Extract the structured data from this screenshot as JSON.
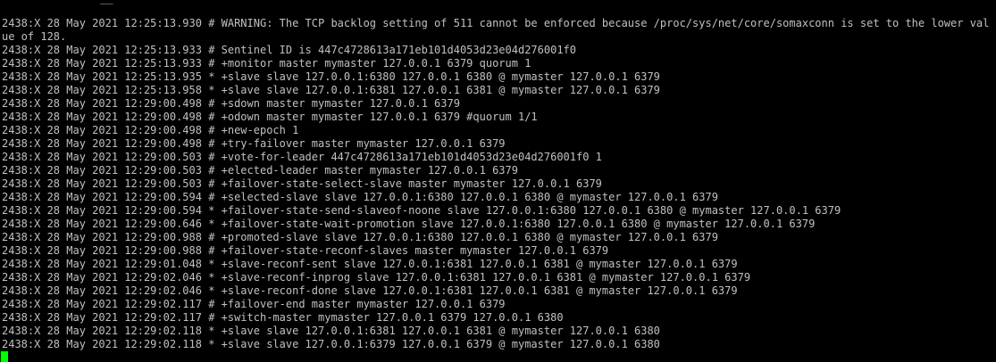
{
  "terminal": {
    "top_fragment": "__",
    "lines": [
      "2438:X 28 May 2021 12:25:13.930 # WARNING: The TCP backlog setting of 511 cannot be enforced because /proc/sys/net/core/somaxconn is set to the lower value of 128.",
      "2438:X 28 May 2021 12:25:13.933 # Sentinel ID is 447c4728613a171eb101d4053d23e04d276001f0",
      "2438:X 28 May 2021 12:25:13.933 # +monitor master mymaster 127.0.0.1 6379 quorum 1",
      "2438:X 28 May 2021 12:25:13.935 * +slave slave 127.0.0.1:6380 127.0.0.1 6380 @ mymaster 127.0.0.1 6379",
      "2438:X 28 May 2021 12:25:13.958 * +slave slave 127.0.0.1:6381 127.0.0.1 6381 @ mymaster 127.0.0.1 6379",
      "2438:X 28 May 2021 12:29:00.498 # +sdown master mymaster 127.0.0.1 6379",
      "2438:X 28 May 2021 12:29:00.498 # +odown master mymaster 127.0.0.1 6379 #quorum 1/1",
      "2438:X 28 May 2021 12:29:00.498 # +new-epoch 1",
      "2438:X 28 May 2021 12:29:00.498 # +try-failover master mymaster 127.0.0.1 6379",
      "2438:X 28 May 2021 12:29:00.503 # +vote-for-leader 447c4728613a171eb101d4053d23e04d276001f0 1",
      "2438:X 28 May 2021 12:29:00.503 # +elected-leader master mymaster 127.0.0.1 6379",
      "2438:X 28 May 2021 12:29:00.503 # +failover-state-select-slave master mymaster 127.0.0.1 6379",
      "2438:X 28 May 2021 12:29:00.594 # +selected-slave slave 127.0.0.1:6380 127.0.0.1 6380 @ mymaster 127.0.0.1 6379",
      "2438:X 28 May 2021 12:29:00.594 * +failover-state-send-slaveof-noone slave 127.0.0.1:6380 127.0.0.1 6380 @ mymaster 127.0.0.1 6379",
      "2438:X 28 May 2021 12:29:00.646 * +failover-state-wait-promotion slave 127.0.0.1:6380 127.0.0.1 6380 @ mymaster 127.0.0.1 6379",
      "2438:X 28 May 2021 12:29:00.988 # +promoted-slave slave 127.0.0.1:6380 127.0.0.1 6380 @ mymaster 127.0.0.1 6379",
      "2438:X 28 May 2021 12:29:00.988 # +failover-state-reconf-slaves master mymaster 127.0.0.1 6379",
      "2438:X 28 May 2021 12:29:01.048 * +slave-reconf-sent slave 127.0.0.1:6381 127.0.0.1 6381 @ mymaster 127.0.0.1 6379",
      "2438:X 28 May 2021 12:29:02.046 * +slave-reconf-inprog slave 127.0.0.1:6381 127.0.0.1 6381 @ mymaster 127.0.0.1 6379",
      "2438:X 28 May 2021 12:29:02.046 * +slave-reconf-done slave 127.0.0.1:6381 127.0.0.1 6381 @ mymaster 127.0.0.1 6379",
      "2438:X 28 May 2021 12:29:02.117 # +failover-end master mymaster 127.0.0.1 6379",
      "2438:X 28 May 2021 12:29:02.117 # +switch-master mymaster 127.0.0.1 6379 127.0.0.1 6380",
      "2438:X 28 May 2021 12:29:02.118 * +slave slave 127.0.0.1:6381 127.0.0.1 6381 @ mymaster 127.0.0.1 6380",
      "2438:X 28 May 2021 12:29:02.118 * +slave slave 127.0.0.1:6379 127.0.0.1 6379 @ mymaster 127.0.0.1 6380"
    ],
    "colors": {
      "background": "#000000",
      "text": "#c0c0c0",
      "cursor": "#00ff00"
    }
  }
}
